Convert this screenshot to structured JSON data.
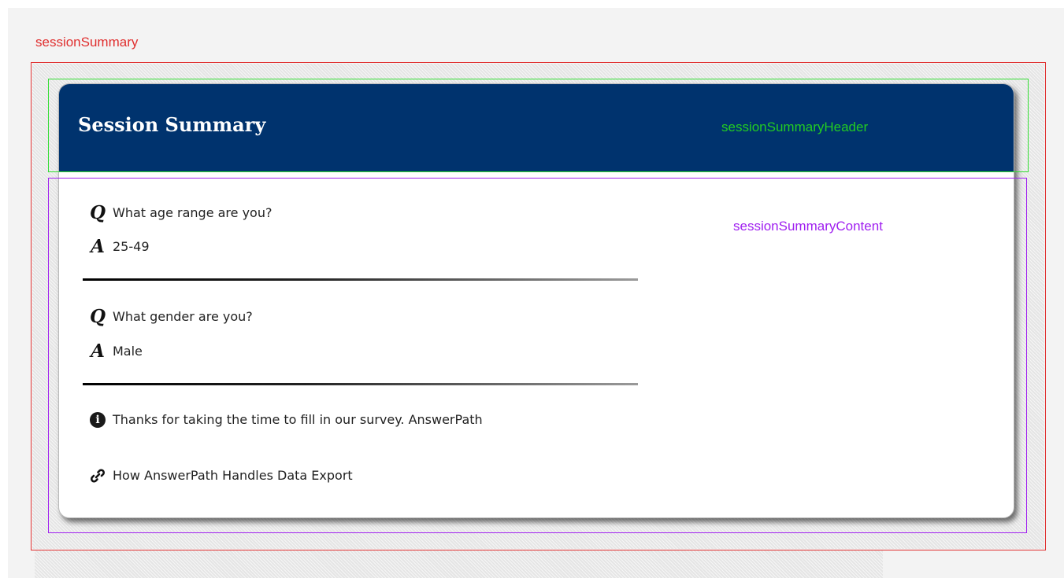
{
  "debug_labels": {
    "session_summary": "sessionSummary",
    "header": "sessionSummaryHeader",
    "content": "sessionSummaryContent"
  },
  "card": {
    "title": "Session Summary"
  },
  "qa_markers": {
    "question": "Q",
    "answer": "A"
  },
  "qa_items": [
    {
      "question": "What age range are you?",
      "answer": "25-49"
    },
    {
      "question": "What gender are you?",
      "answer": "Male"
    }
  ],
  "info": {
    "icon": "info-icon",
    "glyph": "i",
    "text": "Thanks for taking the time to fill in our survey. AnswerPath"
  },
  "link": {
    "icon": "link-icon",
    "text": "How AnswerPath Handles Data Export"
  },
  "colors": {
    "header_bg": "#00336e",
    "session_outline": "#e03030",
    "header_outline": "#33dd33",
    "content_outline": "#a020f0"
  }
}
